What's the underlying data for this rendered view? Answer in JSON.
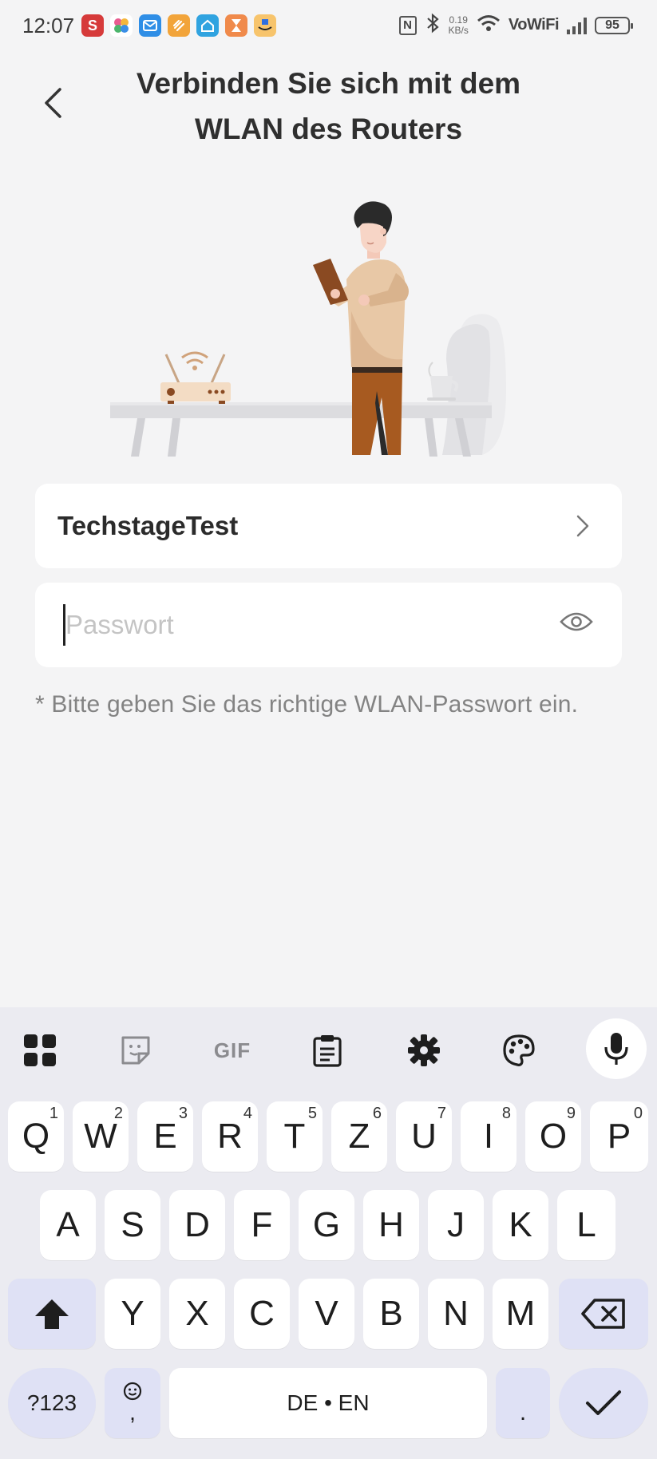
{
  "status_bar": {
    "time": "12:07",
    "speed_value": "0.19",
    "speed_unit": "KB/s",
    "nfc_label": "N",
    "network_label": "VoWiFi",
    "battery": "95",
    "apps": [
      {
        "name": "s-app-icon",
        "glyph": "S",
        "color": "#d63a3a"
      },
      {
        "name": "pinwheel-app-icon",
        "glyph": "",
        "color": "#ffffff"
      },
      {
        "name": "mail-app-icon",
        "glyph": "",
        "color": "#2f8ee6"
      },
      {
        "name": "link-app-icon",
        "glyph": "",
        "color": "#f2a43a"
      },
      {
        "name": "home-app-icon",
        "glyph": "",
        "color": "#30a3e0"
      },
      {
        "name": "hourglass-app-icon",
        "glyph": "",
        "color": "#f08a4b"
      },
      {
        "name": "shopping-app-icon",
        "glyph": "",
        "color": "#f7c46c"
      }
    ]
  },
  "header": {
    "title_line1": "Verbinden Sie sich mit dem",
    "title_line2": "WLAN des Routers"
  },
  "network": {
    "ssid": "TechstageTest"
  },
  "password": {
    "placeholder": "Passwort",
    "value": ""
  },
  "hint": "* Bitte geben Sie das richtige WLAN-Passwort ein.",
  "keyboard": {
    "toolbar": {
      "gif_label": "GIF"
    },
    "row1": [
      {
        "k": "Q",
        "n": "1"
      },
      {
        "k": "W",
        "n": "2"
      },
      {
        "k": "E",
        "n": "3"
      },
      {
        "k": "R",
        "n": "4"
      },
      {
        "k": "T",
        "n": "5"
      },
      {
        "k": "Z",
        "n": "6"
      },
      {
        "k": "U",
        "n": "7"
      },
      {
        "k": "I",
        "n": "8"
      },
      {
        "k": "O",
        "n": "9"
      },
      {
        "k": "P",
        "n": "0"
      }
    ],
    "row2": [
      "A",
      "S",
      "D",
      "F",
      "G",
      "H",
      "J",
      "K",
      "L"
    ],
    "row3": [
      "Y",
      "X",
      "C",
      "V",
      "B",
      "N",
      "M"
    ],
    "sym_label": "?123",
    "emoji_comma": ",",
    "space_label": "DE • EN",
    "period_label": ".",
    "accent_color": "#dfe1f5"
  }
}
